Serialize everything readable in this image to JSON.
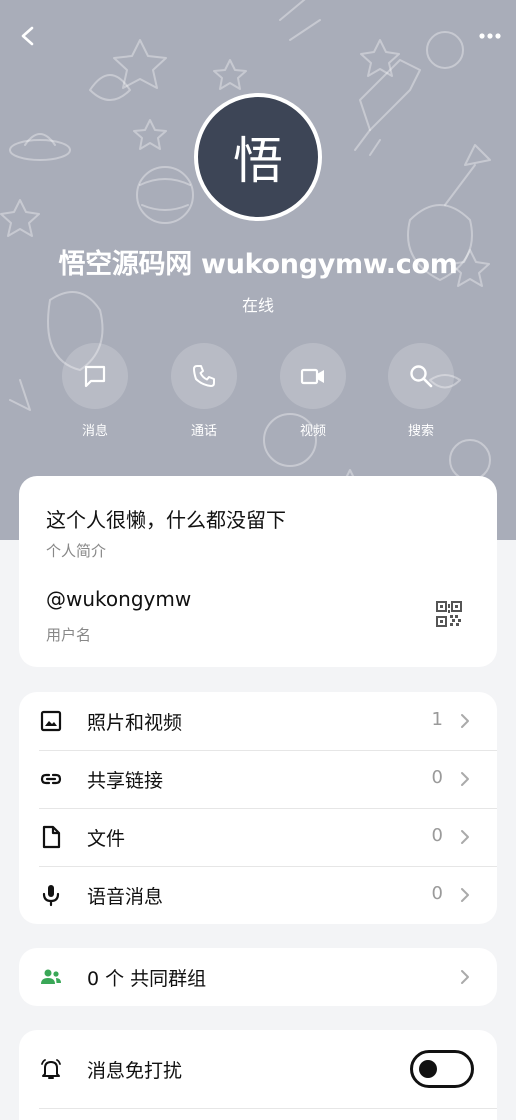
{
  "header": {
    "back_icon": "chevron-left-icon",
    "more_icon": "more-dots-icon"
  },
  "profile": {
    "avatar_initial": "悟",
    "name": "悟空源码网 wukongymw.com",
    "status": "在线"
  },
  "actions": [
    {
      "label": "消息",
      "icon": "message-icon"
    },
    {
      "label": "通话",
      "icon": "phone-icon"
    },
    {
      "label": "视频",
      "icon": "video-icon"
    },
    {
      "label": "搜索",
      "icon": "search-icon"
    }
  ],
  "info": {
    "bio": "这个人很懒，什么都没留下",
    "bio_caption": "个人简介",
    "username": "@wukongymw",
    "username_caption": "用户名",
    "qr_icon": "qr-code-icon"
  },
  "media": [
    {
      "label": "照片和视频",
      "count": "1",
      "icon": "image-icon"
    },
    {
      "label": "共享链接",
      "count": "0",
      "icon": "link-icon"
    },
    {
      "label": "文件",
      "count": "0",
      "icon": "file-icon"
    },
    {
      "label": "语音消息",
      "count": "0",
      "icon": "mic-icon"
    }
  ],
  "groups": {
    "label": "0 个 共同群组",
    "icon": "group-icon",
    "icon_color": "#3aa757"
  },
  "notify": {
    "label": "消息免打扰",
    "icon": "bell-icon",
    "toggle_on": false
  },
  "colors": {
    "header_bg": "#a9adb9",
    "avatar_bg": "#3d4556",
    "page_bg": "#f3f4f6"
  }
}
